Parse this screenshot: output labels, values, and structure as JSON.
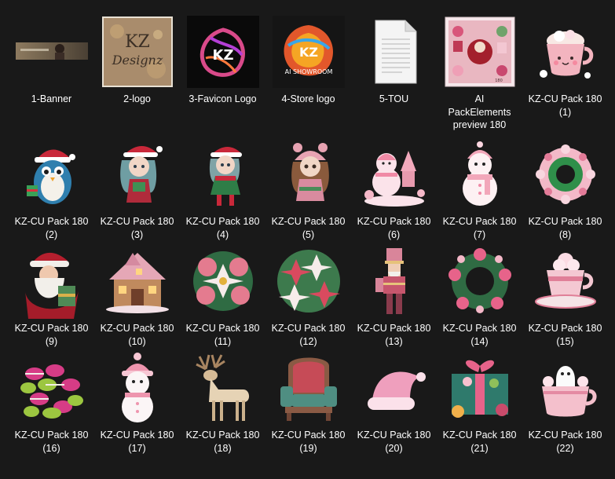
{
  "explorer": {
    "items": [
      {
        "name": "1-Banner",
        "icon": "banner-thumbnail-icon"
      },
      {
        "name": "2-logo",
        "icon": "kz-designz-logo-thumbnail-icon"
      },
      {
        "name": "3-Favicon Logo",
        "icon": "kz-favicon-thumbnail-icon"
      },
      {
        "name": "4-Store logo",
        "icon": "kz-store-logo-thumbnail-icon"
      },
      {
        "name": "5-TOU",
        "icon": "text-document-icon"
      },
      {
        "name": "AI\nPackElements\npreview 180",
        "icon": "pack-preview-thumbnail-icon"
      },
      {
        "name": "KZ-CU Pack 180\n(1)",
        "icon": "pink-cupcake-mug-icon"
      },
      {
        "name": "KZ-CU Pack 180\n(2)",
        "icon": "penguin-santa-hat-icon"
      },
      {
        "name": "KZ-CU Pack 180\n(3)",
        "icon": "girl-teal-hair-santa-icon"
      },
      {
        "name": "KZ-CU Pack 180\n(4)",
        "icon": "elf-girl-green-dress-icon"
      },
      {
        "name": "KZ-CU Pack 180\n(5)",
        "icon": "girl-pink-bear-hat-icon"
      },
      {
        "name": "KZ-CU Pack 180\n(6)",
        "icon": "pink-snowman-scene-icon"
      },
      {
        "name": "KZ-CU Pack 180\n(7)",
        "icon": "pink-snowman-icon"
      },
      {
        "name": "KZ-CU Pack 180\n(8)",
        "icon": "ornament-wreath-icon"
      },
      {
        "name": "KZ-CU Pack 180\n(9)",
        "icon": "santa-claus-icon"
      },
      {
        "name": "KZ-CU Pack 180\n(10)",
        "icon": "gingerbread-house-icon"
      },
      {
        "name": "KZ-CU Pack 180\n(11)",
        "icon": "poinsettia-bouquet-icon"
      },
      {
        "name": "KZ-CU Pack 180\n(12)",
        "icon": "poinsettia-cluster-icon"
      },
      {
        "name": "KZ-CU Pack 180\n(13)",
        "icon": "nutcracker-icon"
      },
      {
        "name": "KZ-CU Pack 180\n(14)",
        "icon": "pink-wreath-icon"
      },
      {
        "name": "KZ-CU Pack 180\n(15)",
        "icon": "cocoa-cup-saucer-icon"
      },
      {
        "name": "KZ-CU Pack 180\n(16)",
        "icon": "macarons-pile-icon"
      },
      {
        "name": "KZ-CU Pack 180\n(17)",
        "icon": "snowman-pink-hat-icon"
      },
      {
        "name": "KZ-CU Pack 180\n(18)",
        "icon": "reindeer-icon"
      },
      {
        "name": "KZ-CU Pack 180\n(19)",
        "icon": "ornate-armchair-icon"
      },
      {
        "name": "KZ-CU Pack 180\n(20)",
        "icon": "pink-santa-hat-icon"
      },
      {
        "name": "KZ-CU Pack 180\n(21)",
        "icon": "gift-box-bow-icon"
      },
      {
        "name": "KZ-CU Pack 180\n(22)",
        "icon": "ghost-pink-cup-icon"
      }
    ]
  },
  "colors": {
    "background": "#191919",
    "text": "#ffffff"
  }
}
